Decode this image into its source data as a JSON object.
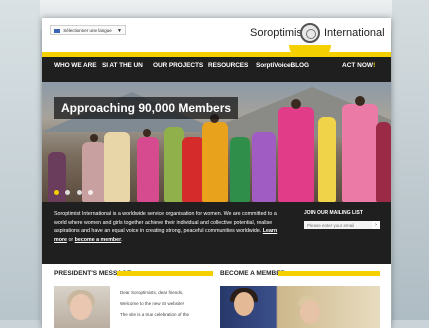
{
  "header": {
    "language_select": "Sélectionner une langue",
    "logo_left": "Soroptimist",
    "logo_right": "International"
  },
  "nav": {
    "items": [
      "WHO WE ARE",
      "SI AT THE UN",
      "OUR PROJECTS",
      "RESOURCES",
      "SorptiVoiceBLOG"
    ],
    "donate": "ACT NOW"
  },
  "hero": {
    "title": "Approaching 90,000 Members",
    "slide_count": 4
  },
  "about": {
    "text": "Soroptimist International is a worldwide service organisation for women. We are committed to a world where women and girls together achieve their individual and collective potential, realise aspirations and have an equal voice in creating strong, peaceful communities worldwide.",
    "learn_more": "Learn more",
    "or": "or",
    "become_member_link": "become a member",
    "mailing_title": "JOIN OUR MAILING LIST",
    "mailing_placeholder": "Please enter your email"
  },
  "sections": {
    "presidents_message": "PRESIDENT'S MESSAGE",
    "become_member": "BECOME A MEMBER",
    "pm_lines": [
      "Dear Soroptimists, dear friends,",
      "Welcome to the new SI website!",
      "The site is a true celebration of the"
    ]
  },
  "colors": {
    "brand_yellow": "#f5d000",
    "dark_bg": "#1f1f1f"
  }
}
